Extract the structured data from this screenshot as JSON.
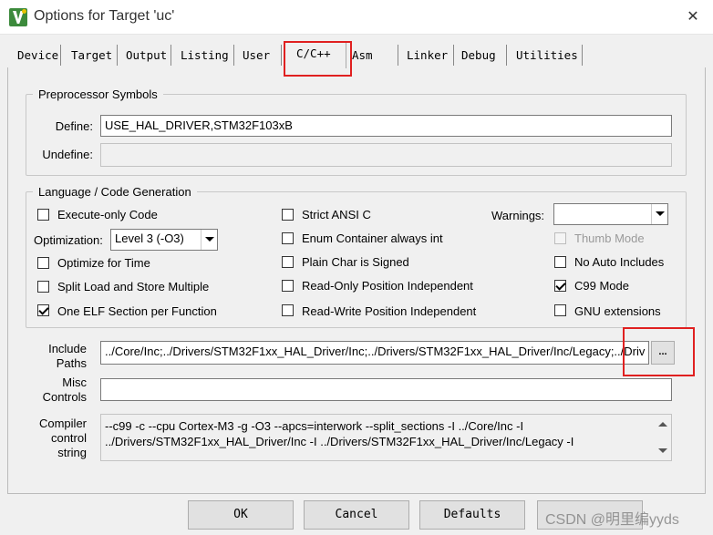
{
  "window": {
    "title": "Options for Target 'uc'",
    "close_glyph": "✕",
    "app_icon": "keil-uvision-icon"
  },
  "tabs": [
    {
      "label": "Device"
    },
    {
      "label": "Target"
    },
    {
      "label": "Output"
    },
    {
      "label": "Listing"
    },
    {
      "label": "User"
    },
    {
      "label": "C/C++",
      "active": true
    },
    {
      "label": "Asm"
    },
    {
      "label": "Linker"
    },
    {
      "label": "Debug"
    },
    {
      "label": "Utilities"
    }
  ],
  "preprocessor": {
    "group_title": "Preprocessor Symbols",
    "define_label": "Define:",
    "define_value": "USE_HAL_DRIVER,STM32F103xB",
    "undefine_label": "Undefine:",
    "undefine_value": ""
  },
  "language": {
    "group_title": "Language / Code Generation",
    "execute_only": {
      "label": "Execute-only Code",
      "checked": false
    },
    "optimization_label": "Optimization:",
    "optimization_value": "Level 3 (-O3)",
    "optimize_time": {
      "label": "Optimize for Time",
      "checked": false
    },
    "split_load": {
      "label": "Split Load and Store Multiple",
      "checked": false
    },
    "one_elf": {
      "label": "One ELF Section per Function",
      "checked": true
    },
    "strict_ansi": {
      "label": "Strict ANSI C",
      "checked": false
    },
    "enum_container": {
      "label": "Enum Container always int",
      "checked": false
    },
    "plain_char": {
      "label": "Plain Char is Signed",
      "checked": false
    },
    "ro_pi": {
      "label": "Read-Only Position Independent",
      "checked": false
    },
    "rw_pi": {
      "label": "Read-Write Position Independent",
      "checked": false
    },
    "warnings_label": "Warnings:",
    "warnings_value": "",
    "thumb_mode": {
      "label": "Thumb Mode",
      "checked": false,
      "disabled": true
    },
    "no_auto_includes": {
      "label": "No Auto Includes",
      "checked": false
    },
    "c99_mode": {
      "label": "C99 Mode",
      "checked": true
    },
    "gnu_extensions": {
      "label": "GNU extensions",
      "checked": false
    }
  },
  "include": {
    "label": "Include\nPaths",
    "value": "../Core/Inc;../Drivers/STM32F1xx_HAL_Driver/Inc;../Drivers/STM32F1xx_HAL_Driver/Inc/Legacy;../Driv",
    "browse_label": "..."
  },
  "misc": {
    "label": "Misc\nControls",
    "value": ""
  },
  "compiler": {
    "label": "Compiler\ncontrol\nstring",
    "value": "--c99 -c --cpu Cortex-M3 -g -O3 --apcs=interwork --split_sections -I ../Core/Inc -I ../Drivers/STM32F1xx_HAL_Driver/Inc -I ../Drivers/STM32F1xx_HAL_Driver/Inc/Legacy -I"
  },
  "buttons": {
    "ok": "OK",
    "cancel": "Cancel",
    "defaults": "Defaults"
  },
  "watermark": "CSDN @明里编yyds",
  "colors": {
    "highlight": "#e02020",
    "dialog_bg": "#f0f0f0"
  }
}
